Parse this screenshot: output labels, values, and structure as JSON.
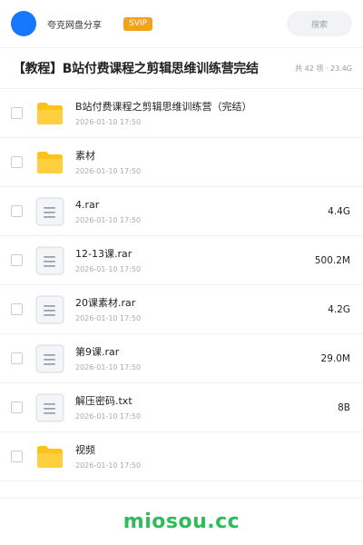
{
  "header": {
    "share_name": "夸克网盘分享",
    "badge": "SVIP",
    "search_placeholder": "搜索"
  },
  "title_bar": {
    "title": "【教程】B站付费课程之剪辑思维训练营完结",
    "summary": "共 42 项 · 23.4G"
  },
  "files": [
    {
      "type": "folder",
      "icon": "folder-icon",
      "name": "B站付费课程之剪辑思维训练营（完结）",
      "date": "2026-01-10 17:50",
      "size": ""
    },
    {
      "type": "folder",
      "icon": "folder-icon",
      "name": "素材",
      "date": "2026-01-10 17:50",
      "size": ""
    },
    {
      "type": "file",
      "icon": "file-icon",
      "name": "4.rar",
      "date": "2026-01-10 17:50",
      "size": "4.4G"
    },
    {
      "type": "file",
      "icon": "file-icon",
      "name": "12-13课.rar",
      "date": "2026-01-10 17:50",
      "size": "500.2M"
    },
    {
      "type": "file",
      "icon": "file-icon",
      "name": "20课素材.rar",
      "date": "2026-01-10 17:50",
      "size": "4.2G"
    },
    {
      "type": "file",
      "icon": "file-icon",
      "name": "第9课.rar",
      "date": "2026-01-10 17:50",
      "size": "29.0M"
    },
    {
      "type": "file",
      "icon": "file-icon",
      "name": "解压密码.txt",
      "date": "2026-01-10 17:50",
      "size": "8B"
    },
    {
      "type": "folder",
      "icon": "folder-icon",
      "name": "视频",
      "date": "2026-01-10 17:50",
      "size": ""
    }
  ],
  "footer": {
    "brand": "miosou.cc"
  },
  "colors": {
    "avatar": "#1677ff",
    "svip_badge": "#f3a21b",
    "folder": "#ffc21a",
    "brand": "#2ebb5a"
  }
}
